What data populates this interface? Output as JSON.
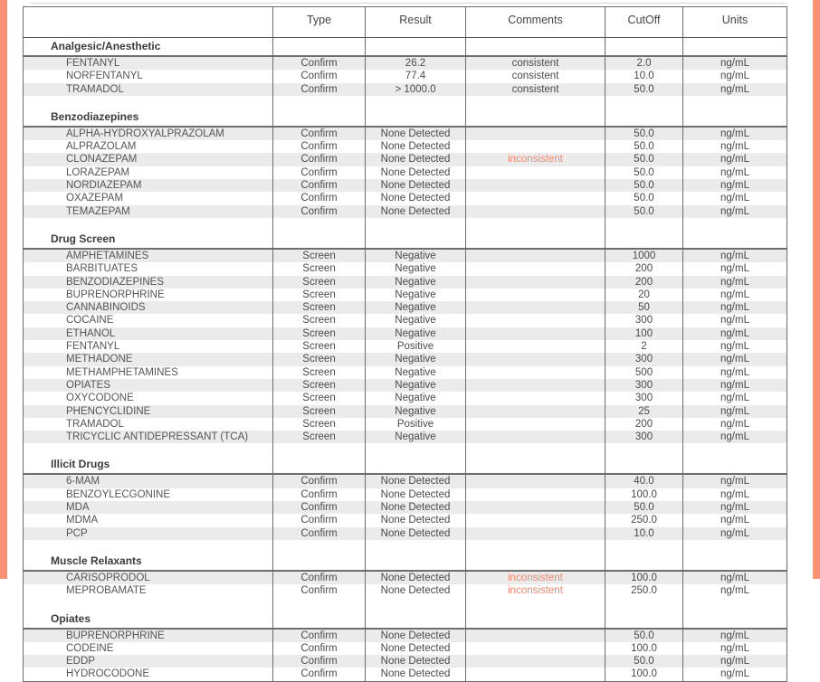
{
  "accent_color": "#f79274",
  "flag_color": "#f9846a",
  "table": {
    "columns": [
      "",
      "Type",
      "Result",
      "Comments",
      "CutOff",
      "Units"
    ],
    "groups": [
      {
        "name": "Analgesic/Anesthetic",
        "rows": [
          {
            "analyte": "FENTANYL",
            "type": "Confirm",
            "result": "26.2",
            "comments": "consistent",
            "cutoff": "2.0",
            "units": "ng/mL"
          },
          {
            "analyte": "NORFENTANYL",
            "type": "Confirm",
            "result": "77.4",
            "comments": "consistent",
            "cutoff": "10.0",
            "units": "ng/mL"
          },
          {
            "analyte": "TRAMADOL",
            "type": "Confirm",
            "result": "> 1000.0",
            "comments": "consistent",
            "cutoff": "50.0",
            "units": "ng/mL"
          }
        ]
      },
      {
        "name": "Benzodiazepines",
        "rows": [
          {
            "analyte": "ALPHA-HYDROXYALPRAZOLAM",
            "type": "Confirm",
            "result": "None Detected",
            "comments": "",
            "cutoff": "50.0",
            "units": "ng/mL"
          },
          {
            "analyte": "ALPRAZOLAM",
            "type": "Confirm",
            "result": "None Detected",
            "comments": "",
            "cutoff": "50.0",
            "units": "ng/mL"
          },
          {
            "analyte": "CLONAZEPAM",
            "type": "Confirm",
            "result": "None Detected",
            "comments": "inconsistent",
            "cutoff": "50.0",
            "units": "ng/mL"
          },
          {
            "analyte": "LORAZEPAM",
            "type": "Confirm",
            "result": "None Detected",
            "comments": "",
            "cutoff": "50.0",
            "units": "ng/mL"
          },
          {
            "analyte": "NORDIAZEPAM",
            "type": "Confirm",
            "result": "None Detected",
            "comments": "",
            "cutoff": "50.0",
            "units": "ng/mL"
          },
          {
            "analyte": "OXAZEPAM",
            "type": "Confirm",
            "result": "None Detected",
            "comments": "",
            "cutoff": "50.0",
            "units": "ng/mL"
          },
          {
            "analyte": "TEMAZEPAM",
            "type": "Confirm",
            "result": "None Detected",
            "comments": "",
            "cutoff": "50.0",
            "units": "ng/mL"
          }
        ]
      },
      {
        "name": "Drug Screen",
        "rows": [
          {
            "analyte": "AMPHETAMINES",
            "type": "Screen",
            "result": "Negative",
            "comments": "",
            "cutoff": "1000",
            "units": "ng/mL"
          },
          {
            "analyte": "BARBITUATES",
            "type": "Screen",
            "result": "Negative",
            "comments": "",
            "cutoff": "200",
            "units": "ng/mL"
          },
          {
            "analyte": "BENZODIAZEPINES",
            "type": "Screen",
            "result": "Negative",
            "comments": "",
            "cutoff": "200",
            "units": "ng/mL"
          },
          {
            "analyte": "BUPRENORPHRINE",
            "type": "Screen",
            "result": "Negative",
            "comments": "",
            "cutoff": "20",
            "units": "ng/mL"
          },
          {
            "analyte": "CANNABINOIDS",
            "type": "Screen",
            "result": "Negative",
            "comments": "",
            "cutoff": "50",
            "units": "ng/mL"
          },
          {
            "analyte": "COCAINE",
            "type": "Screen",
            "result": "Negative",
            "comments": "",
            "cutoff": "300",
            "units": "ng/mL"
          },
          {
            "analyte": "ETHANOL",
            "type": "Screen",
            "result": "Negative",
            "comments": "",
            "cutoff": "100",
            "units": "ng/mL"
          },
          {
            "analyte": "FENTANYL",
            "type": "Screen",
            "result": "Positive",
            "comments": "",
            "cutoff": "2",
            "units": "ng/mL"
          },
          {
            "analyte": "METHADONE",
            "type": "Screen",
            "result": "Negative",
            "comments": "",
            "cutoff": "300",
            "units": "ng/mL"
          },
          {
            "analyte": "METHAMPHETAMINES",
            "type": "Screen",
            "result": "Negative",
            "comments": "",
            "cutoff": "500",
            "units": "ng/mL"
          },
          {
            "analyte": "OPIATES",
            "type": "Screen",
            "result": "Negative",
            "comments": "",
            "cutoff": "300",
            "units": "ng/mL"
          },
          {
            "analyte": "OXYCODONE",
            "type": "Screen",
            "result": "Negative",
            "comments": "",
            "cutoff": "300",
            "units": "ng/mL"
          },
          {
            "analyte": "PHENCYCLIDINE",
            "type": "Screen",
            "result": "Negative",
            "comments": "",
            "cutoff": "25",
            "units": "ng/mL"
          },
          {
            "analyte": "TRAMADOL",
            "type": "Screen",
            "result": "Positive",
            "comments": "",
            "cutoff": "200",
            "units": "ng/mL"
          },
          {
            "analyte": "TRICYCLIC ANTIDEPRESSANT (TCA)",
            "type": "Screen",
            "result": "Negative",
            "comments": "",
            "cutoff": "300",
            "units": "ng/mL"
          }
        ]
      },
      {
        "name": "Illicit Drugs",
        "rows": [
          {
            "analyte": "6-MAM",
            "type": "Confirm",
            "result": "None Detected",
            "comments": "",
            "cutoff": "40.0",
            "units": "ng/mL"
          },
          {
            "analyte": "BENZOYLECGONINE",
            "type": "Confirm",
            "result": "None Detected",
            "comments": "",
            "cutoff": "100.0",
            "units": "ng/mL"
          },
          {
            "analyte": "MDA",
            "type": "Confirm",
            "result": "None Detected",
            "comments": "",
            "cutoff": "50.0",
            "units": "ng/mL"
          },
          {
            "analyte": "MDMA",
            "type": "Confirm",
            "result": "None Detected",
            "comments": "",
            "cutoff": "250.0",
            "units": "ng/mL"
          },
          {
            "analyte": "PCP",
            "type": "Confirm",
            "result": "None Detected",
            "comments": "",
            "cutoff": "10.0",
            "units": "ng/mL"
          }
        ]
      },
      {
        "name": "Muscle Relaxants",
        "rows": [
          {
            "analyte": "CARISOPRODOL",
            "type": "Confirm",
            "result": "None Detected",
            "comments": "inconsistent",
            "cutoff": "100.0",
            "units": "ng/mL"
          },
          {
            "analyte": "MEPROBAMATE",
            "type": "Confirm",
            "result": "None Detected",
            "comments": "inconsistent",
            "cutoff": "250.0",
            "units": "ng/mL"
          }
        ]
      },
      {
        "name": "Opiates",
        "rows": [
          {
            "analyte": "BUPRENORPHRINE",
            "type": "Confirm",
            "result": "None Detected",
            "comments": "",
            "cutoff": "50.0",
            "units": "ng/mL"
          },
          {
            "analyte": "CODEINE",
            "type": "Confirm",
            "result": "None Detected",
            "comments": "",
            "cutoff": "100.0",
            "units": "ng/mL"
          },
          {
            "analyte": "EDDP",
            "type": "Confirm",
            "result": "None Detected",
            "comments": "",
            "cutoff": "50.0",
            "units": "ng/mL"
          },
          {
            "analyte": "HYDROCODONE",
            "type": "Confirm",
            "result": "None Detected",
            "comments": "",
            "cutoff": "100.0",
            "units": "ng/mL"
          }
        ]
      }
    ]
  }
}
